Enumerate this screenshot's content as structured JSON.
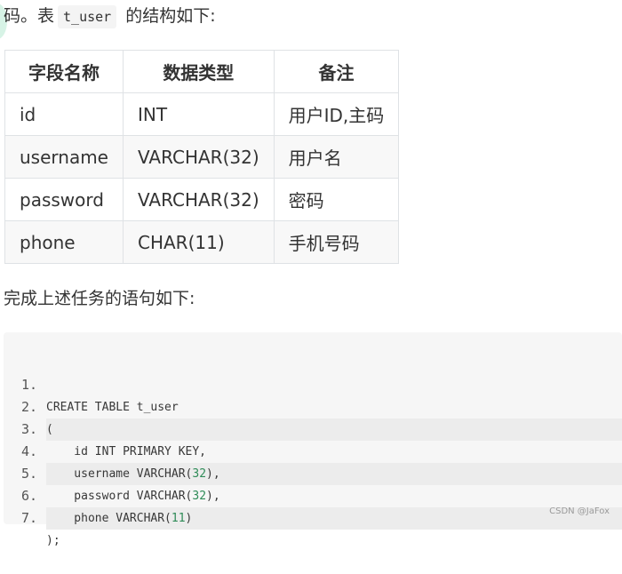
{
  "intro": {
    "before": "码。表",
    "code": "t_user",
    "after": " 的结构如下:"
  },
  "table": {
    "headers": [
      "字段名称",
      "数据类型",
      "备注"
    ],
    "rows": [
      [
        "id",
        "INT",
        "用户ID,主码"
      ],
      [
        "username",
        "VARCHAR(32)",
        "用户名"
      ],
      [
        "password",
        "VARCHAR(32)",
        "密码"
      ],
      [
        "phone",
        "CHAR(11)",
        "手机号码"
      ]
    ]
  },
  "lead": "完成上述任务的语句如下:",
  "code": {
    "lines": [
      {
        "num": "1.",
        "text": "CREATE TABLE t_user"
      },
      {
        "num": "2.",
        "text": "("
      },
      {
        "num": "3.",
        "text": "    id INT PRIMARY KEY,"
      },
      {
        "num": "4.",
        "text": "    username VARCHAR(32),"
      },
      {
        "num": "5.",
        "text": "    password VARCHAR(32),"
      },
      {
        "num": "6.",
        "text": "    phone VARCHAR(11)"
      },
      {
        "num": "7.",
        "text": ");"
      }
    ]
  },
  "watermark": "CSDN @JaFox"
}
